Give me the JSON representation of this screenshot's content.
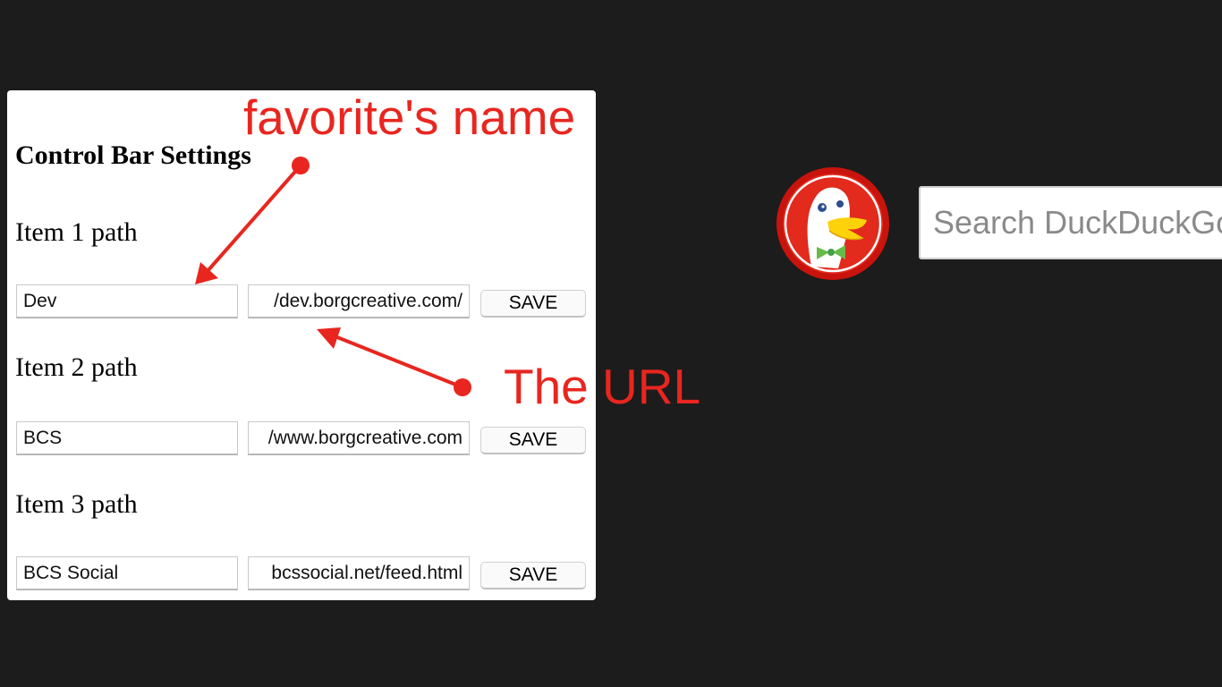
{
  "settings": {
    "title": "Control Bar Settings",
    "items": [
      {
        "label": "Item 1 path",
        "name": "Dev",
        "url": "/dev.borgcreative.com/",
        "save_label": "SAVE"
      },
      {
        "label": "Item 2 path",
        "name": "BCS",
        "url": "www.borgcreative.com/",
        "save_label": "SAVE"
      },
      {
        "label": "Item 3 path",
        "name": "BCS Social",
        "url": "bcssocial.net/feed.html",
        "save_label": "SAVE"
      }
    ]
  },
  "annotations": {
    "name_note": "favorite's name",
    "url_note": "The URL",
    "color": "#e8261f"
  },
  "search": {
    "placeholder": "Search DuckDuckGo"
  },
  "icons": {
    "logo": "duckduckgo-logo-icon"
  }
}
